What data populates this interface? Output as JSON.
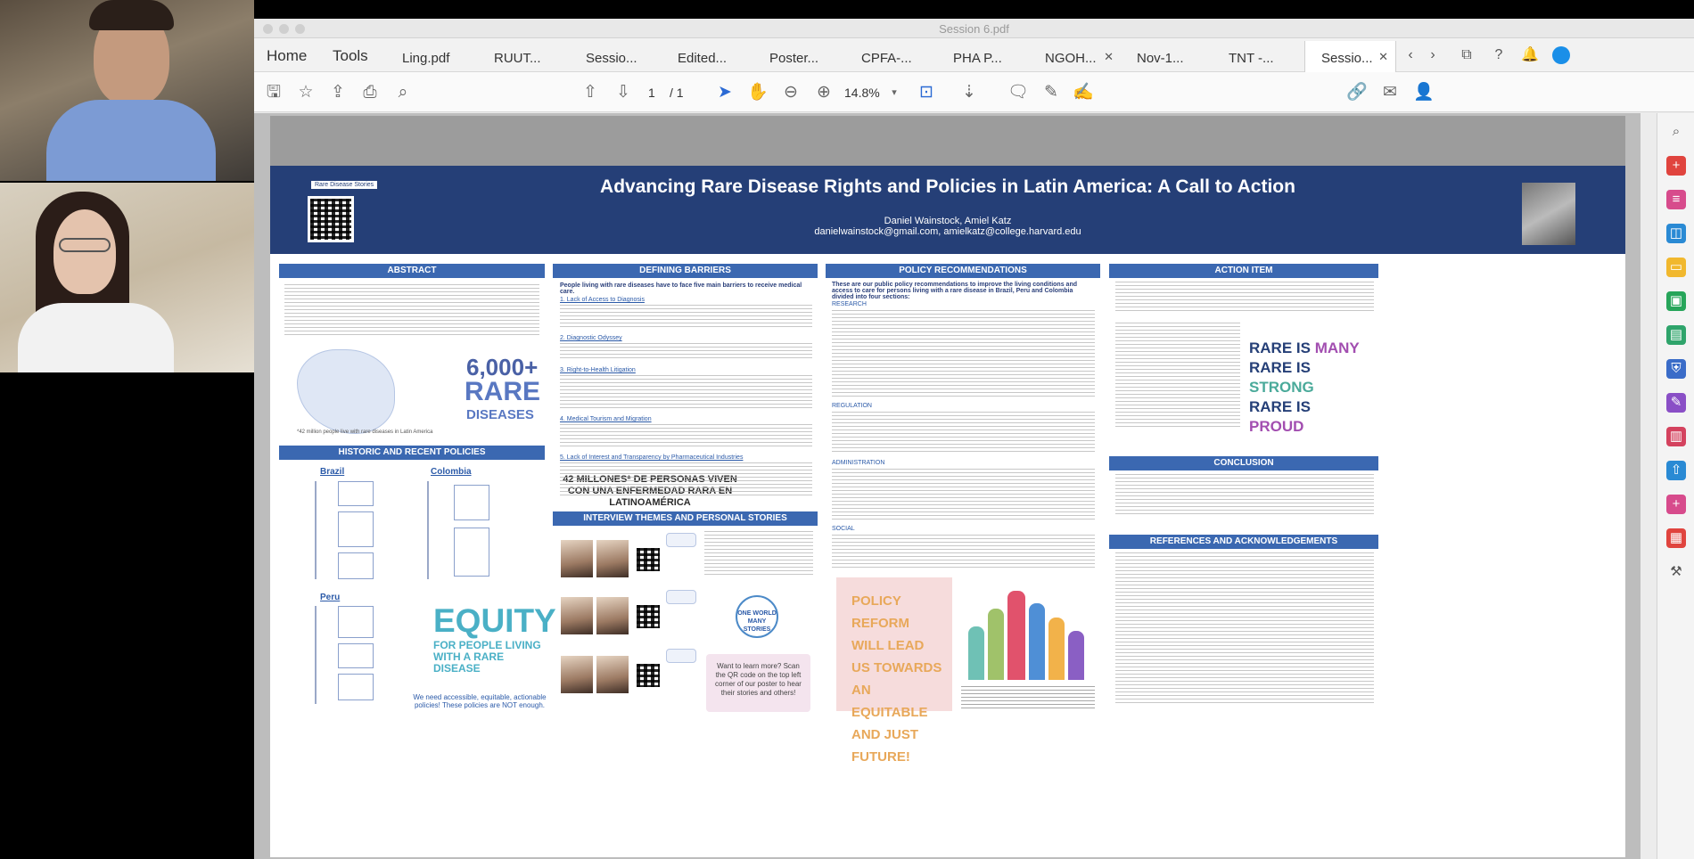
{
  "window": {
    "title": "Session 6.pdf"
  },
  "nav": {
    "home": "Home",
    "tools": "Tools"
  },
  "tabs": [
    {
      "label": "Ling.pdf"
    },
    {
      "label": "RUUT..."
    },
    {
      "label": "Sessio..."
    },
    {
      "label": "Edited..."
    },
    {
      "label": "Poster..."
    },
    {
      "label": "CPFA-..."
    },
    {
      "label": "PHA P..."
    },
    {
      "label": "NGOH..."
    },
    {
      "label": "Nov-1..."
    },
    {
      "label": "TNT -..."
    },
    {
      "label": "Sessio..."
    }
  ],
  "toolbar": {
    "page_current": "1",
    "page_total": "/ 1",
    "zoom": "14.8%"
  },
  "poster": {
    "title": "Advancing Rare Disease Rights and Policies in Latin America: A Call to Action",
    "authors": "Daniel Wainstock, Amiel Katz",
    "emails": "danielwainstock@gmail.com, amielkatz@college.harvard.edu",
    "qr_label": "Rare Disease Stories",
    "sections": {
      "abstract": "ABSTRACT",
      "barriers": "DEFINING BARRIERS",
      "policy": "POLICY RECOMMENDATIONS",
      "action": "ACTION ITEM",
      "historic": "HISTORIC AND RECENT POLICIES",
      "interviews": "INTERVIEW THEMES AND PERSONAL STORIES",
      "conclusion": "CONCLUSION",
      "references": "REFERENCES AND ACKNOWLEDGEMENTS"
    },
    "barriers_intro": "People living with rare diseases have to face five main barriers to receive medical care.",
    "policy_intro": "These are our public policy recommendations to improve the living conditions and access to care for persons living with a rare disease in Brazil, Peru and Colombia divided into four sections:",
    "barrier_items": [
      "1. Lack of Access to Diagnosis",
      "2. Diagnostic Odyssey",
      "3. Right-to-Health Litigation",
      "4. Medical Tourism and Migration",
      "5. Lack of Interest and Transparency by Pharmaceutical Industries"
    ],
    "policy_sub": {
      "research": "RESEARCH",
      "regulation": "REGULATION",
      "admin": "ADMINISTRATION",
      "social": "SOCIAL"
    },
    "countries": {
      "brazil": "Brazil",
      "colombia": "Colombia",
      "peru": "Peru"
    },
    "millones": "42 MILLONES* DE PERSONAS VIVEN CON UNA ENFERMEDAD RARA EN LATINOAMÉRICA",
    "millones_caption": "*42 million people live with rare diseases in Latin America",
    "big_number": "6,000+",
    "rare_word": "RARE",
    "diseases_word": "DISEASES",
    "equity_word": "EQUITY",
    "equity_sub": "FOR PEOPLE LIVING WITH A RARE DISEASE",
    "equity_note": "We need accessible, equitable, actionable policies! These policies are NOT enough.",
    "policy_card": "POLICY REFORM WILL LEAD US TOWARDS AN EQUITABLE AND JUST FUTURE!",
    "rare_is": [
      "RARE IS ",
      "MANY",
      "RARE IS ",
      "STRONG",
      "RARE IS ",
      "PROUD"
    ],
    "oneworld": "ONE WORLD MANY STORIES",
    "qr_bubble": "Want to learn more? Scan the QR code on the top left corner of our poster to hear their stories and others!"
  }
}
